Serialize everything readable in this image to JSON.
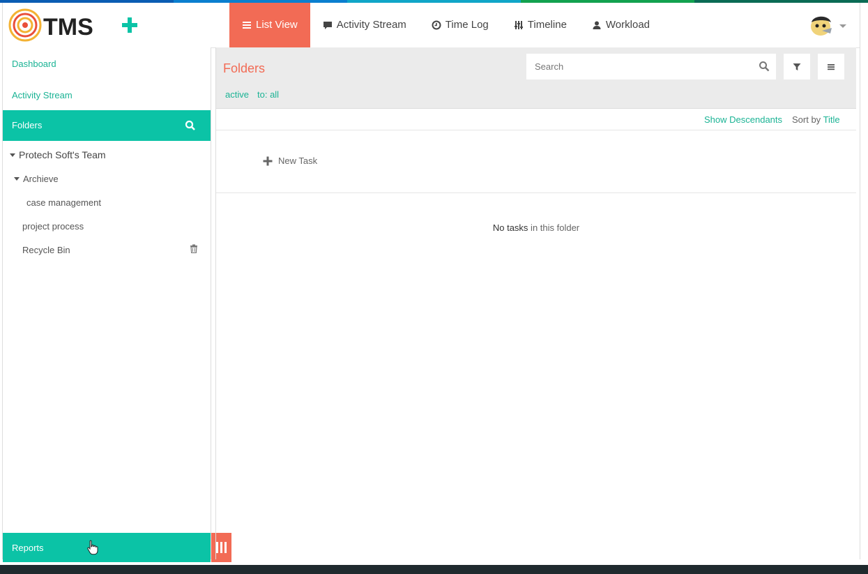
{
  "app": {
    "logo_text": "TMS",
    "stripe_colors": [
      "#0a5db3",
      "#0a7fcf",
      "#10a6c8",
      "#12a24f",
      "#0a6b55"
    ],
    "accent": "#f26b55",
    "teal": "#0bc3a6"
  },
  "nav": {
    "items": [
      {
        "label": "List View",
        "icon": "list-icon",
        "active": true
      },
      {
        "label": "Activity Stream",
        "icon": "comment-icon"
      },
      {
        "label": "Time Log",
        "icon": "clock-icon"
      },
      {
        "label": "Timeline",
        "icon": "sliders-icon"
      },
      {
        "label": "Workload",
        "icon": "user-icon"
      }
    ]
  },
  "sidebar": {
    "dashboard": "Dashboard",
    "activity_stream": "Activity Stream",
    "folders_label": "Folders",
    "tree": {
      "team": "Protech Soft's Team",
      "archieve": "Archieve",
      "case_management": "case management",
      "project_process": "project process",
      "recycle_bin": "Recycle Bin"
    },
    "reports_label": "Reports"
  },
  "main": {
    "title": "Folders",
    "search_placeholder": "Search",
    "filters": [
      "active",
      "to: all"
    ],
    "show_descendants": "Show Descendants",
    "sort_by_label": "Sort by",
    "sort_by_value": "Title",
    "new_task": "New Task",
    "empty_bold": "No tasks",
    "empty_rest": " in this folder"
  }
}
